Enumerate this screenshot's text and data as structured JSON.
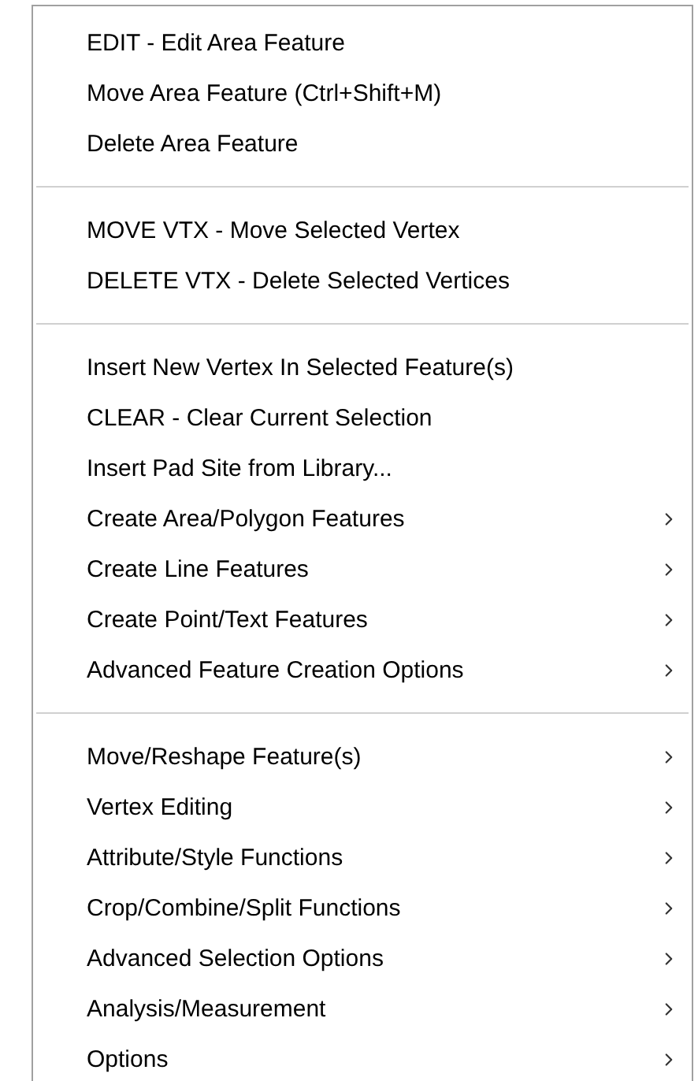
{
  "menu": {
    "groups": [
      {
        "items": [
          {
            "label": "EDIT - Edit Area Feature",
            "submenu": false
          },
          {
            "label": "Move Area Feature (Ctrl+Shift+M)",
            "submenu": false
          },
          {
            "label": "Delete Area Feature",
            "submenu": false
          }
        ]
      },
      {
        "items": [
          {
            "label": "MOVE VTX - Move Selected Vertex",
            "submenu": false
          },
          {
            "label": "DELETE VTX - Delete Selected Vertices",
            "submenu": false
          }
        ]
      },
      {
        "items": [
          {
            "label": "Insert New Vertex In Selected Feature(s)",
            "submenu": false
          },
          {
            "label": "CLEAR - Clear Current Selection",
            "submenu": false
          },
          {
            "label": "Insert Pad Site from Library...",
            "submenu": false
          },
          {
            "label": "Create Area/Polygon Features",
            "submenu": true
          },
          {
            "label": "Create Line Features",
            "submenu": true
          },
          {
            "label": "Create Point/Text Features",
            "submenu": true
          },
          {
            "label": "Advanced Feature Creation Options",
            "submenu": true
          }
        ]
      },
      {
        "items": [
          {
            "label": "Move/Reshape Feature(s)",
            "submenu": true
          },
          {
            "label": "Vertex Editing",
            "submenu": true
          },
          {
            "label": "Attribute/Style Functions",
            "submenu": true
          },
          {
            "label": "Crop/Combine/Split Functions",
            "submenu": true
          },
          {
            "label": "Advanced Selection Options",
            "submenu": true
          },
          {
            "label": "Analysis/Measurement",
            "submenu": true
          },
          {
            "label": "Options",
            "submenu": true
          }
        ]
      }
    ]
  }
}
